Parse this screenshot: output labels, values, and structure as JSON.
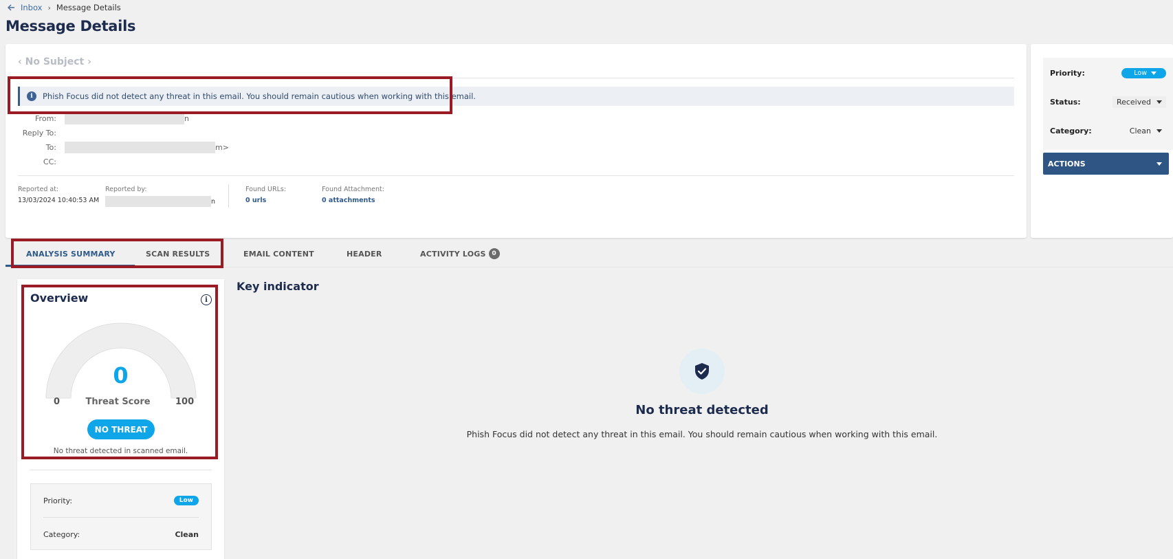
{
  "breadcrumb": {
    "back_icon": "arrow-left-icon",
    "inbox": "Inbox",
    "separator": "›",
    "current": "Message Details"
  },
  "page_title": "Message Details",
  "message": {
    "subject": "‹ No Subject ›",
    "notice": "Phish Focus did not detect any threat in this email. You should remain cautious when working with this email.",
    "fields": {
      "from_label": "From:",
      "from_tail": "n",
      "reply_to_label": "Reply To:",
      "to_label": "To:",
      "to_tail": "m>",
      "cc_label": "CC:"
    },
    "meta": {
      "reported_at_label": "Reported at:",
      "reported_at_value": "13/03/2024 10:40:53 AM",
      "reported_by_label": "Reported by:",
      "reported_by_tail": "n",
      "found_urls_label": "Found URLs:",
      "found_urls_value": "0 urls",
      "found_attachment_label": "Found Attachment:",
      "found_attachment_value": "0 attachments"
    }
  },
  "side_panel": {
    "priority_label": "Priority:",
    "priority_value": "Low",
    "status_label": "Status:",
    "status_value": "Received",
    "category_label": "Category:",
    "category_value": "Clean",
    "actions_label": "ACTIONS"
  },
  "tabs": [
    {
      "label": "ANALYSIS SUMMARY",
      "active": true
    },
    {
      "label": "SCAN RESULTS"
    },
    {
      "label": "EMAIL CONTENT"
    },
    {
      "label": "HEADER"
    },
    {
      "label": "ACTIVITY LOGS",
      "badge": "0"
    }
  ],
  "overview": {
    "title": "Overview",
    "threat_score": 0,
    "score_text": "0",
    "gauge_min": "0",
    "gauge_max": "100",
    "gauge_label": "Threat Score",
    "verdict_button": "NO THREAT",
    "caption": "No threat detected in scanned email.",
    "priority_label": "Priority:",
    "priority_value": "Low",
    "category_label": "Category:",
    "category_value": "Clean"
  },
  "key_indicator": {
    "title": "Key indicator",
    "icon": "shield-check-icon",
    "headline": "No threat detected",
    "description": "Phish Focus did not detect any threat in this email. You should remain cautious when working with this email."
  },
  "colors": {
    "accent": "#0ea5e9",
    "navy": "#1d2b4e",
    "actions": "#2f5584",
    "highlight": "#9b1b24"
  }
}
